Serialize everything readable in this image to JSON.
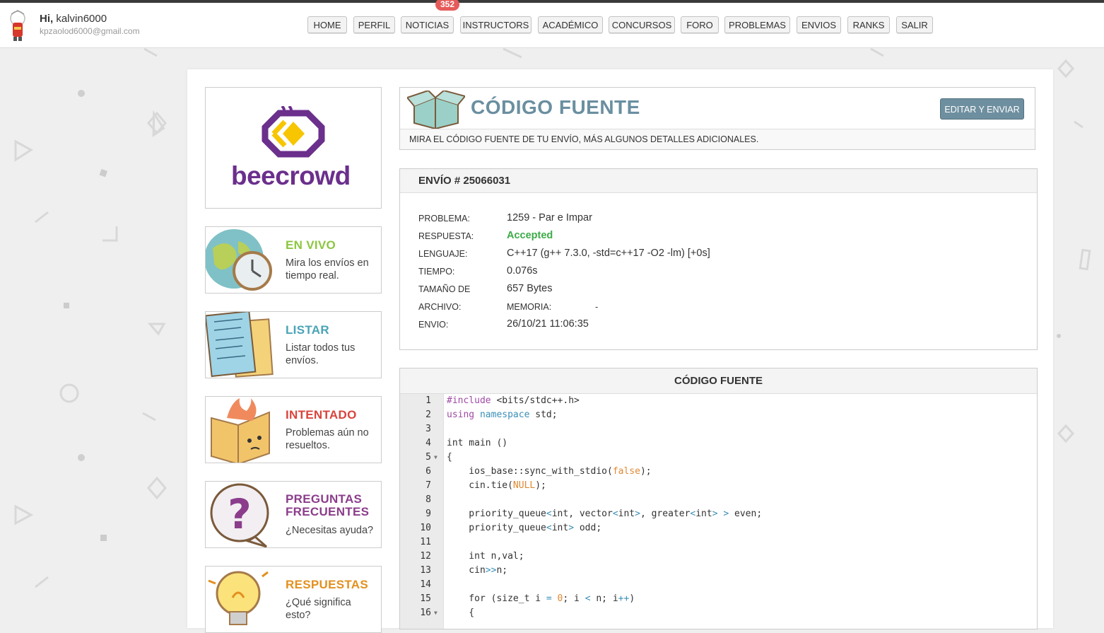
{
  "header": {
    "greeting_prefix": "Hi,",
    "username": "kalvin6000",
    "email": "kpzaolod6000@gmail.com"
  },
  "nav": {
    "items": [
      "HOME",
      "PERFIL",
      "NOTICIAS",
      "INSTRUCTORS",
      "ACADÉMICO",
      "CONCURSOS",
      "FORO",
      "PROBLEMAS",
      "ENVIOS",
      "RANKS",
      "SALIR"
    ],
    "notifications_badge": "352"
  },
  "logo": {
    "text": "beecrowd"
  },
  "sidebar": {
    "items": [
      {
        "title": "EN VIVO",
        "desc": "Mira los envíos en tiempo real.",
        "color": "#8cc63f"
      },
      {
        "title": "LISTAR",
        "desc": "Listar todos tus envíos.",
        "color": "#4aa3b8"
      },
      {
        "title": "INTENTADO",
        "desc": "Problemas aún no resueltos.",
        "color": "#d9443c"
      },
      {
        "title": "PREGUNTAS FRECUENTES",
        "desc": "¿Necesitas ayuda?",
        "color": "#8b3d8b"
      },
      {
        "title": "RESPUESTAS",
        "desc": "¿Qué significa esto?",
        "color": "#e3901f"
      }
    ]
  },
  "codigo_fuente_panel": {
    "title": "CÓDIGO FUENTE",
    "button": "EDITAR Y ENVIAR",
    "subtitle": "MIRA EL CÓDIGO FUENTE DE TU ENVÍO, MÁS ALGUNOS DETALLES ADICIONALES."
  },
  "envio": {
    "header": "ENVÍO # 25066031",
    "problema_label": "PROBLEMA:",
    "problema": "1259 - Par e Impar",
    "respuesta_label": "RESPUESTA:",
    "respuesta": "Accepted",
    "lenguaje_label": "LENGUAJE:",
    "lenguaje": "C++17 (g++ 7.3.0, -std=c++17 -O2 -lm) [+0s]",
    "tiempo_label": "TIEMPO:",
    "tiempo": "0.076s",
    "tamano_label": "TAMAÑO DE",
    "tamano": "657 Bytes",
    "archivo_label": "ARCHIVO:",
    "memoria_label": "MEMORIA:",
    "memoria": "-",
    "envio_label": "ENVIO:",
    "fecha": "26/10/21 11:06:35"
  },
  "code": {
    "header": "CÓDIGO FUENTE",
    "lines": [
      "#include <bits/stdc++.h>",
      "using namespace std;",
      "",
      "int main ()",
      "{",
      "    ios_base::sync_with_stdio(false);",
      "    cin.tie(NULL);",
      "",
      "    priority_queue<int, vector<int>, greater<int> > even;",
      "    priority_queue<int> odd;",
      "",
      "    int n,val;",
      "    cin>>n;",
      "",
      "    for (size_t i = 0; i < n; i++)",
      "    {"
    ]
  }
}
